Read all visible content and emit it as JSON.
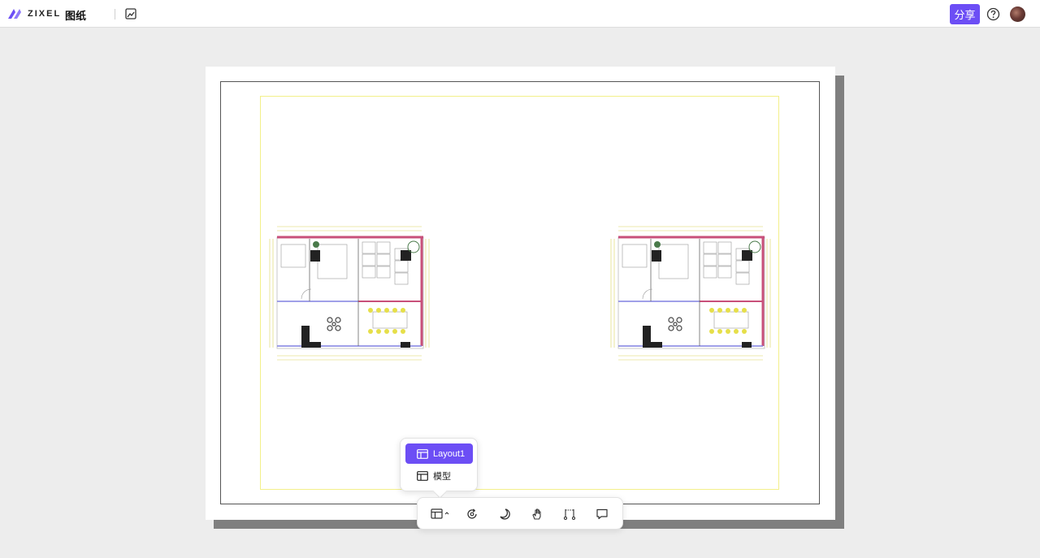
{
  "header": {
    "logo_text": "ZIXEL",
    "title": "图纸",
    "share_label": "分享",
    "icons": [
      "zixel-logo-icon",
      "edit-image-icon",
      "help-icon",
      "avatar"
    ]
  },
  "layout_menu": {
    "items": [
      {
        "label": "Layout1",
        "active": true
      },
      {
        "label": "模型",
        "active": false
      }
    ]
  },
  "toolbar": {
    "icons": [
      "layout-icon",
      "rotate-icon",
      "dark-mode-icon",
      "pan-hand-icon",
      "measure-icon",
      "comment-icon"
    ]
  },
  "colors": {
    "accent": "#6c4ef5",
    "background": "#ededed",
    "sheet": "#ffffff",
    "viewport_frame": "#f3f08a"
  }
}
